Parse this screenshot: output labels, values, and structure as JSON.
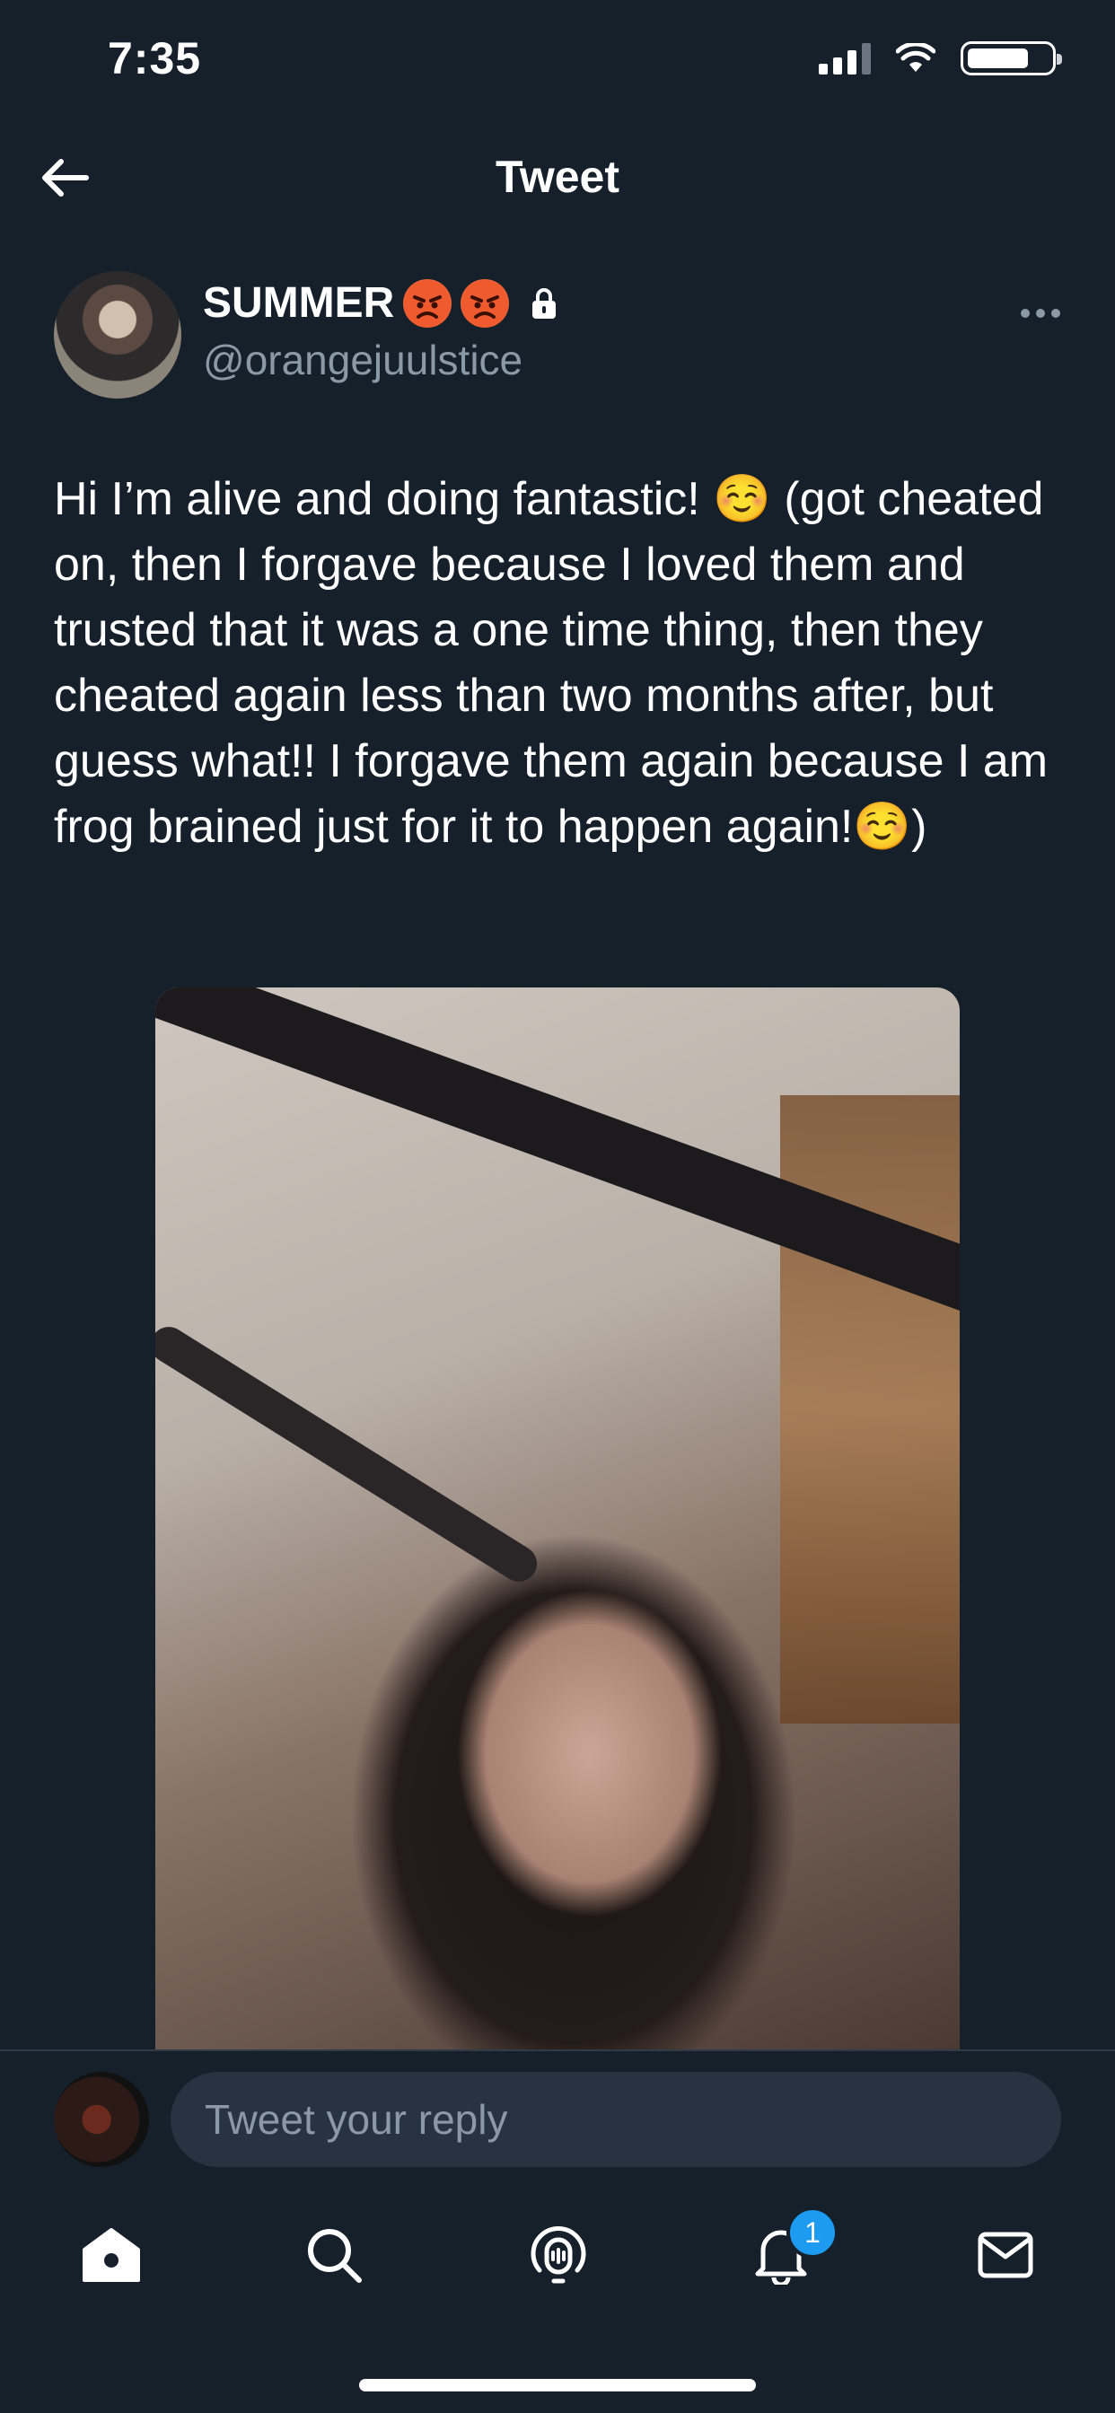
{
  "status_bar": {
    "time": "7:35"
  },
  "header": {
    "title": "Tweet"
  },
  "tweet": {
    "author_name": "SUMMER",
    "handle": "@orangejuulstice",
    "text": "Hi I’m alive and doing fantastic! ☺️ (got cheated on, then I forgave because I loved them and trusted that it was a one time thing, then they cheated again less than two months after, but guess what!! I forgave them again because I am frog brained just for it to happen again!☺️)"
  },
  "reply": {
    "placeholder": "Tweet your reply"
  },
  "tab_bar": {
    "notifications_badge": "1"
  },
  "colors": {
    "background": "#15202b",
    "accent": "#1d9bf0",
    "secondary_text": "#8b98a5",
    "input_bg": "#273340"
  },
  "icons": [
    "back-arrow-icon",
    "lock-icon",
    "more-icon",
    "home-icon",
    "search-icon",
    "spaces-icon",
    "notifications-icon",
    "messages-icon"
  ]
}
